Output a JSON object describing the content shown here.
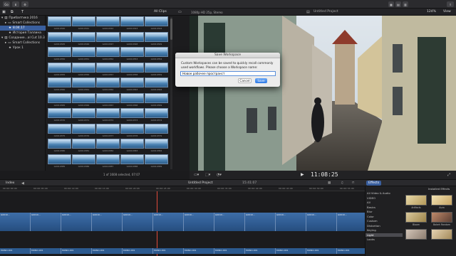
{
  "toolbar": {
    "left_buttons": [
      "Go"
    ],
    "right_icons": [
      "grid-icon",
      "layout-icon",
      "inspector-icon",
      "share-icon"
    ]
  },
  "browser_header": {
    "filter": "All Clips",
    "project_format": "1080p HD 25p, Stereo",
    "project_name": "Untitled Project",
    "zoom": "124%",
    "view_menu": "View"
  },
  "library": {
    "items": [
      {
        "label": "Прибалтика 2016",
        "indent": 0,
        "selected": false
      },
      {
        "label": "Smart Collections",
        "indent": 1,
        "selected": false
      },
      {
        "label": "8.04.17",
        "indent": 1,
        "selected": true
      },
      {
        "label": "История Таллина",
        "indent": 1,
        "selected": false
      },
      {
        "label": "Создание...al Cut 10.3",
        "indent": 0,
        "selected": false
      },
      {
        "label": "Smart Collections",
        "indent": 1,
        "selected": false
      },
      {
        "label": "Урок 1",
        "indent": 1,
        "selected": false
      }
    ]
  },
  "browser": {
    "clips": [
      "G0010340",
      "G0010341",
      "G0010342",
      "G0010343",
      "G0010344",
      "G0010345",
      "G0010346",
      "G0010347",
      "G0010348",
      "G0010349",
      "G0010350",
      "G0010351",
      "G0010352",
      "G0010353",
      "G0010354",
      "G0010355",
      "G0010356",
      "G0010357",
      "G0010358",
      "G0010359",
      "G0010360",
      "G0010361",
      "G0010362",
      "G0010363",
      "G0010364",
      "G0010365",
      "G0010366",
      "G0010367",
      "G0010368",
      "G0010369",
      "G0010370",
      "G0010371",
      "G0010372",
      "G0010373",
      "G0010374",
      "G0010375",
      "G0010376",
      "G0010377",
      "G0010378",
      "G0010379",
      "G0010380",
      "G0010381",
      "G0010382",
      "G0010383",
      "G0010384",
      "G0010385",
      "G0010386",
      "G0010387",
      "G0010388",
      "G0010389"
    ],
    "status": "1 of 1608 selected, 07:07"
  },
  "viewer": {
    "timecode": "11:08:25"
  },
  "timeline": {
    "index_label": "Index",
    "project_label": "Untitled Project",
    "duration": "15:41:07",
    "ruler_marks": [
      "00:00:00:00",
      "00:00:05:00",
      "00:00:10:00",
      "00:00:15:00",
      "00:00:20:00",
      "00:00:25:00",
      "00:00:30:00",
      "00:00:35:00",
      "00:00:40:00",
      "00:00:45:00",
      "00:00:50:00",
      "00:00:55:00"
    ],
    "clip_labels": [
      "G0010...",
      "G0010...",
      "G0010...",
      "G0010...",
      "G0010...",
      "G0010...",
      "G0010...",
      "G0010...",
      "G0010...",
      "G0010...",
      "G0010...",
      "G0010..."
    ],
    "audio_labels": [
      "MONO-001",
      "MONO-001",
      "MONO-001",
      "MONO-001",
      "MONO-001",
      "MONO-001",
      "MONO-001",
      "MONO-001",
      "MONO-001",
      "MONO-001",
      "MONO-001",
      "MONO-001"
    ]
  },
  "effects": {
    "tab": "Effects",
    "installed": "Installed Effects",
    "categories": [
      "All Video & Audio",
      "VIDEO",
      "All",
      "Basics",
      "Blur",
      "Color",
      "Custom",
      "Distortion",
      "Keying",
      "Light",
      "Looks"
    ],
    "selected_category": "Light",
    "items": [
      "Artifacts",
      "Aura",
      "Bloom",
      "Bokeh Random",
      "",
      ""
    ]
  },
  "dialog": {
    "title": "Save Workspace",
    "message": "Custom Workspaces can be saved to quickly recall commonly used workflows. Please choose a Workspace name:",
    "input_value": "Новое рабочее пространст",
    "cancel": "Cancel",
    "save": "Save"
  }
}
